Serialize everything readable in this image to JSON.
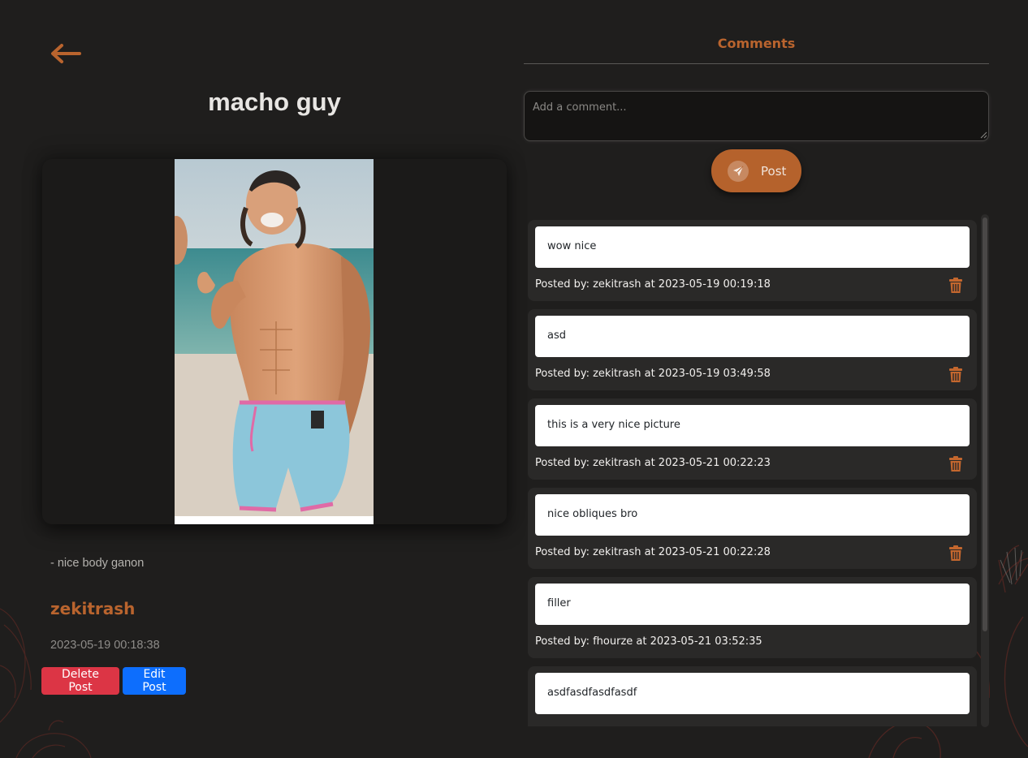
{
  "post": {
    "title": "macho guy",
    "description": "- nice body ganon",
    "author": "zekitrash",
    "date": "2023-05-19 00:18:38",
    "image_alt": "macho guy"
  },
  "actions": {
    "delete_label": "Delete Post",
    "edit_label": "Edit Post"
  },
  "comments_section": {
    "heading": "Comments",
    "placeholder": "Add a comment...",
    "post_label": "Post"
  },
  "comments": [
    {
      "text": "wow nice",
      "meta": "Posted by: zekitrash at 2023-05-19 00:19:18",
      "deletable": true
    },
    {
      "text": "asd",
      "meta": "Posted by: zekitrash at 2023-05-19 03:49:58",
      "deletable": true
    },
    {
      "text": "this is a very nice picture",
      "meta": "Posted by: zekitrash at 2023-05-21 00:22:23",
      "deletable": true
    },
    {
      "text": "nice obliques bro",
      "meta": "Posted by: zekitrash at 2023-05-21 00:22:28",
      "deletable": true
    },
    {
      "text": "filler",
      "meta": "Posted by: fhourze at 2023-05-21 03:52:35",
      "deletable": false
    },
    {
      "text": "asdfasdfasdfasdf",
      "meta": "",
      "deletable": false
    }
  ],
  "icons": {
    "back": "arrow-left-icon",
    "send": "paper-plane-icon",
    "delete": "trash-icon"
  },
  "colors": {
    "background": "#1f1e1d",
    "accent": "#b9642e",
    "delete_button": "#dc3545",
    "edit_button": "#0d6efd"
  }
}
